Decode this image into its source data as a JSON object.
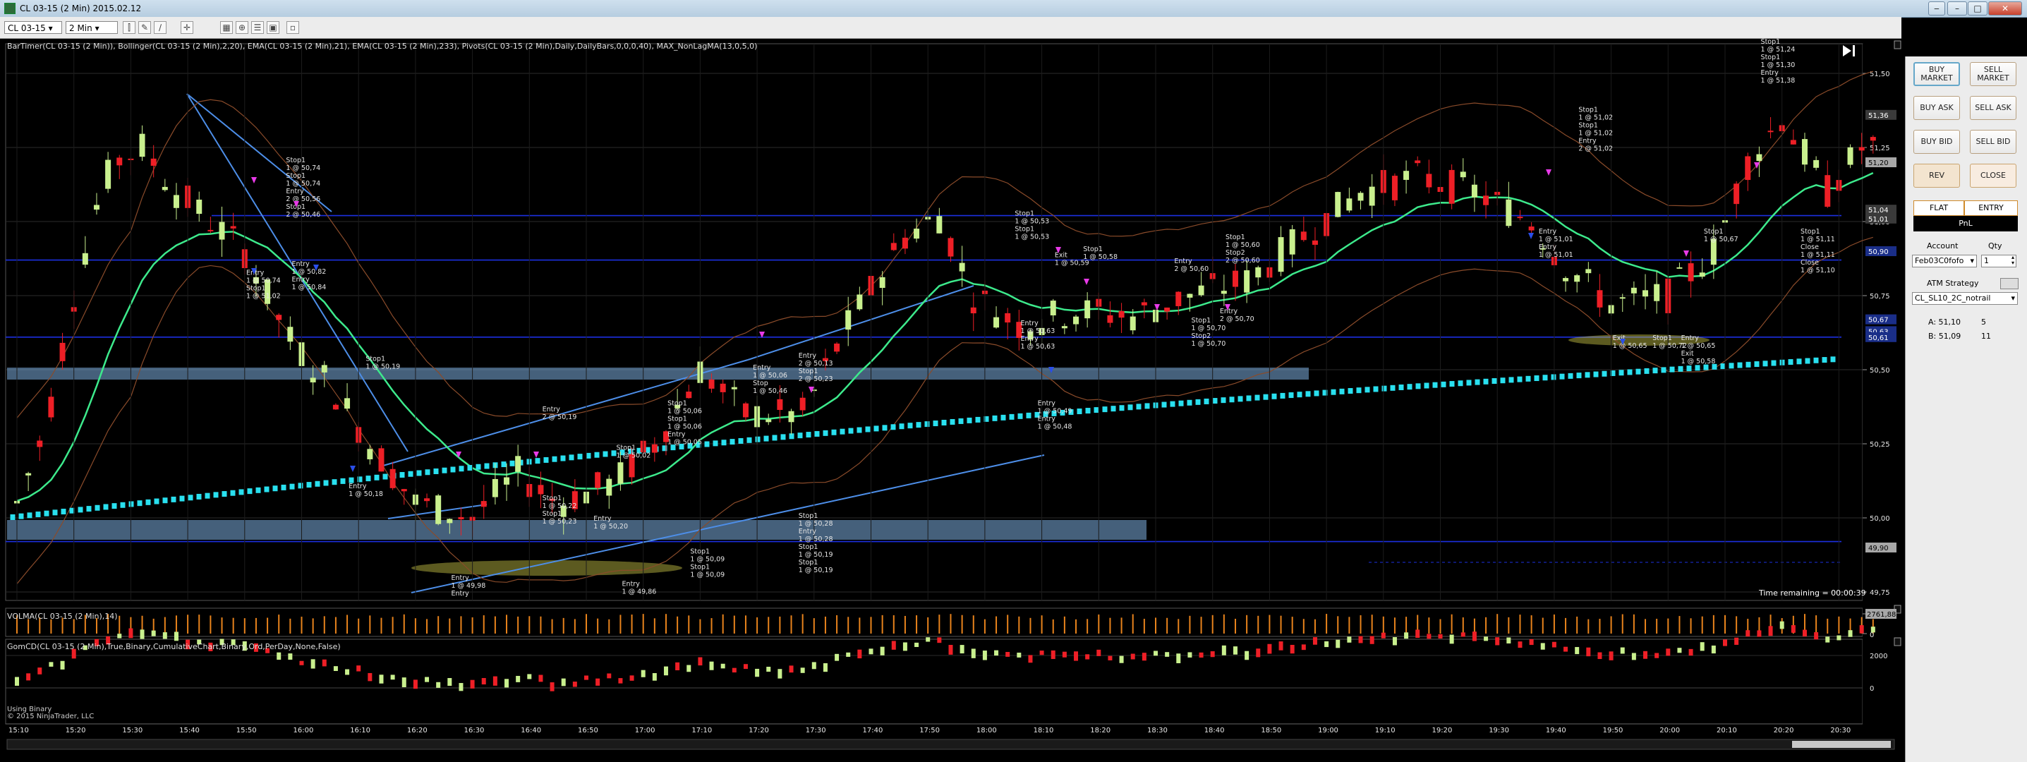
{
  "window": {
    "title": "CL 03-15 (2 Min)  2015.02.12"
  },
  "toolbar": {
    "instrument": "CL 03-15",
    "interval": "2 Min"
  },
  "studies_label": "BarTimer(CL 03-15 (2 Min)), Bollinger(CL 03-15 (2 Min),2,20), EMA(CL 03-15 (2 Min),21), EMA(CL 03-15 (2 Min),233), Pivots(CL 03-15 (2 Min),Daily,DailyBars,0,0,0,40), MAX_NonLagMA(13,0,5,0)",
  "volma_label": "VOLMA(CL 03-15 (2 Min),14)",
  "gomcd_label": "GomCD(CL 03-15 (2 Min),True,Binary,CumulativeChart,Binary,Ord,PerDay,None,False)",
  "binary_label": "Using Binary",
  "copyright": "© 2015 NinjaTrader, LLC",
  "time_remaining": "Time remaining = 00:00:39",
  "price_axis": [
    "51,50",
    "51,25",
    "51,00",
    "50,75",
    "50,50",
    "50,25",
    "50,00",
    "49,75"
  ],
  "price_tags": [
    {
      "text": "51,36",
      "bg": "#3a3a3a",
      "fg": "#fff"
    },
    {
      "text": "51,20",
      "bg": "#a7a7a7",
      "fg": "#000"
    },
    {
      "text": "51,04",
      "bg": "#3a3a3a",
      "fg": "#fff"
    },
    {
      "text": "51,01",
      "bg": "#3a3a3a",
      "fg": "#fff"
    },
    {
      "text": "50,90",
      "bg": "#1a2e88",
      "fg": "#fff"
    },
    {
      "text": "50,67",
      "bg": "#1a2e88",
      "fg": "#fff"
    },
    {
      "text": "50,63",
      "bg": "#1a2e88",
      "fg": "#fff"
    },
    {
      "text": "50,61",
      "bg": "#1a2e88",
      "fg": "#fff"
    },
    {
      "text": "49,90",
      "bg": "#a7a7a7",
      "fg": "#000"
    }
  ],
  "vol_axis": [
    "2761,88",
    "0"
  ],
  "gomcd_axis": [
    "2000",
    "0"
  ],
  "time_axis": [
    "15:10",
    "15:20",
    "15:30",
    "15:40",
    "15:50",
    "16:00",
    "16:10",
    "16:20",
    "16:30",
    "16:40",
    "16:50",
    "17:00",
    "17:10",
    "17:20",
    "17:30",
    "17:40",
    "17:50",
    "18:00",
    "18:10",
    "18:20",
    "18:30",
    "18:40",
    "18:50",
    "19:00",
    "19:10",
    "19:20",
    "19:30",
    "19:40",
    "19:50",
    "20:00",
    "20:10",
    "20:20",
    "20:30"
  ],
  "annotations": [
    {
      "lines": [
        "Stop1",
        "1 @ 50,74",
        "Stop1",
        "1 @ 50,74",
        "Entry",
        "2 @ 50,56",
        "Stop1",
        "2 @ 50,46"
      ],
      "price": 51.2,
      "time": "15:59"
    },
    {
      "lines": [
        "Entry",
        "1 @ 50,74",
        "Stop1",
        "1 @ 51,02"
      ],
      "price": 50.82,
      "time": "15:52"
    },
    {
      "lines": [
        "Entry",
        "1 @ 50,82",
        "Entry",
        "1 @ 50,84"
      ],
      "price": 50.85,
      "time": "16:00"
    },
    {
      "lines": [
        "Stop1",
        "1 @ 50,19"
      ],
      "price": 50.53,
      "time": "16:13"
    },
    {
      "lines": [
        "Entry",
        "1 @ 50,18"
      ],
      "price": 50.1,
      "time": "16:10"
    },
    {
      "lines": [
        "Entry",
        "2 @ 50,19"
      ],
      "price": 50.36,
      "time": "16:44"
    },
    {
      "lines": [
        "Stop1",
        "1 @ 50,22",
        "Stop1",
        "1 @ 50,23"
      ],
      "price": 50.06,
      "time": "16:44"
    },
    {
      "lines": [
        "Stop1",
        "1 @ 50,02"
      ],
      "price": 50.23,
      "time": "16:57"
    },
    {
      "lines": [
        "Entry",
        "1 @ 50,20"
      ],
      "price": 49.99,
      "time": "16:53"
    },
    {
      "lines": [
        "Stop1",
        "1 @ 50,06",
        "Stop1",
        "1 @ 50,06",
        "Entry",
        "1 @ 50,05"
      ],
      "price": 50.38,
      "time": "17:06"
    },
    {
      "lines": [
        "Stop1",
        "1 @ 50,09",
        "Stop1",
        "1 @ 50,09"
      ],
      "price": 49.88,
      "time": "17:10"
    },
    {
      "lines": [
        "Entry",
        "1 @ 49,98",
        "Entry"
      ],
      "price": 49.79,
      "time": "16:28"
    },
    {
      "lines": [
        "Entry",
        "1 @ 49,86"
      ],
      "price": 49.77,
      "time": "16:58"
    },
    {
      "lines": [
        "Entry",
        "1 @ 50,06",
        "Stop",
        "1 @ 50,46"
      ],
      "price": 50.5,
      "time": "17:21"
    },
    {
      "lines": [
        "Entry",
        "2 @ 50,13",
        "Stop1",
        "2 @ 50,23"
      ],
      "price": 50.54,
      "time": "17:29"
    },
    {
      "lines": [
        "Stop1",
        "1 @ 50,28",
        "Entry",
        "1 @ 50,28",
        "Stop1",
        "1 @ 50,19",
        "Stop1",
        "1 @ 50,19"
      ],
      "price": 50.0,
      "time": "17:29"
    },
    {
      "lines": [
        "Stop1",
        "1 @ 50,53",
        "Stop1",
        "1 @ 50,53"
      ],
      "price": 51.02,
      "time": "18:07"
    },
    {
      "lines": [
        "Exit",
        "1 @ 50,59"
      ],
      "price": 50.88,
      "time": "18:14"
    },
    {
      "lines": [
        "Stop1",
        "1 @ 50,58"
      ],
      "price": 50.9,
      "time": "18:19"
    },
    {
      "lines": [
        "Entry",
        "1 @ 50,63",
        "Entry",
        "1 @ 50,63"
      ],
      "price": 50.65,
      "time": "18:08"
    },
    {
      "lines": [
        "Entry",
        "1 @ 50,49",
        "Entry",
        "1 @ 50,48"
      ],
      "price": 50.38,
      "time": "18:11"
    },
    {
      "lines": [
        "Entry",
        "2 @ 50,60"
      ],
      "price": 50.86,
      "time": "18:35"
    },
    {
      "lines": [
        "Stop1",
        "1 @ 50,60",
        "Stop2",
        "2 @ 50,60"
      ],
      "price": 50.94,
      "time": "18:44"
    },
    {
      "lines": [
        "Stop1",
        "1 @ 50,70",
        "Stop2",
        "1 @ 50,70"
      ],
      "price": 50.66,
      "time": "18:38"
    },
    {
      "lines": [
        "Entry",
        "2 @ 50,70"
      ],
      "price": 50.69,
      "time": "18:43"
    },
    {
      "lines": [
        "Stop1",
        "1 @ 51,02",
        "Stop1",
        "1 @ 51,02",
        "Entry",
        "2 @ 51,02"
      ],
      "price": 51.37,
      "time": "19:46"
    },
    {
      "lines": [
        "Entry",
        "1 @ 51,01",
        "Entry",
        "1 @ 51,01"
      ],
      "price": 50.96,
      "time": "19:39"
    },
    {
      "lines": [
        "Exit",
        "1 @ 50,65"
      ],
      "price": 50.6,
      "time": "19:52"
    },
    {
      "lines": [
        "Stop1",
        "1 @ 50,72"
      ],
      "price": 50.6,
      "time": "19:59"
    },
    {
      "lines": [
        "Entry",
        "1 @ 50,65",
        "Exit",
        "1 @ 50,58"
      ],
      "price": 50.6,
      "time": "20:04"
    },
    {
      "lines": [
        "Stop1",
        "1 @ 50,67"
      ],
      "price": 50.96,
      "time": "20:08"
    },
    {
      "lines": [
        "Stop1",
        "1 @ 51,24",
        "Stop1",
        "1 @ 51,30",
        "Entry",
        "1 @ 51,38"
      ],
      "price": 51.6,
      "time": "20:18"
    },
    {
      "lines": [
        "Stop1",
        "1 @ 51,11",
        "Close",
        "1 @ 51,11",
        "Close",
        "1 @ 51,10"
      ],
      "price": 50.96,
      "time": "20:25"
    }
  ],
  "side_panel": {
    "buy_market": "BUY MARKET",
    "sell_market": "SELL MARKET",
    "buy_ask": "BUY ASK",
    "sell_ask": "SELL ASK",
    "buy_bid": "BUY BID",
    "sell_bid": "SELL BID",
    "rev": "REV",
    "close": "CLOSE",
    "flat": "FLAT",
    "entry": "ENTRY",
    "pnl": "PnL",
    "account_label": "Account",
    "qty_label": "Qty",
    "account_value": "Feb03C0fofo",
    "qty_value": "1",
    "atm_label": "ATM Strategy",
    "atm_value": "CL_SL10_2C_notrail",
    "ask_label": "A: 51,10",
    "ask_size": "5",
    "bid_label": "B: 51,09",
    "bid_size": "11"
  },
  "colors": {
    "up": "#c9f08e",
    "down": "#ee1f26",
    "ema21": "#3dea8c",
    "ema233": "#29e0ef",
    "pivot": "#1c2fe0",
    "zone": "#7eaee0",
    "trend": "#4d8ee8",
    "volume": "#e8831c"
  }
}
